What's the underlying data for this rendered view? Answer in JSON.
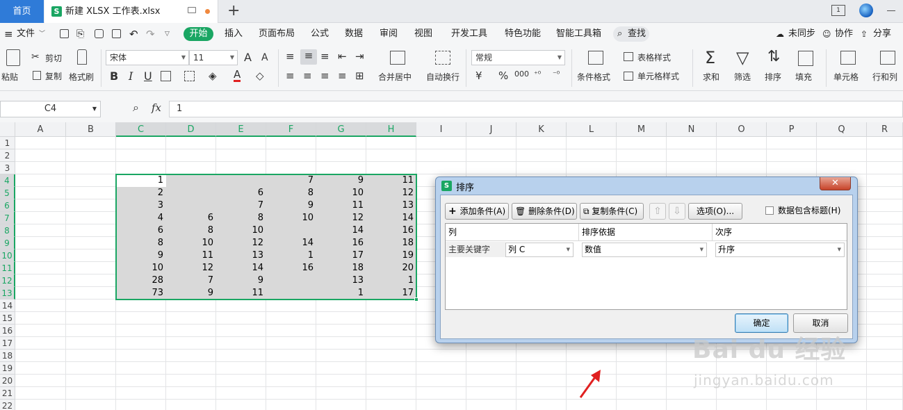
{
  "tabbar": {
    "home": "首页",
    "file_logo": "S",
    "file_name": "新建 XLSX 工作表.xlsx",
    "plus": "+",
    "book_icon_text": "1"
  },
  "menubar": {
    "file_menu": "文件",
    "items": [
      "开始",
      "插入",
      "页面布局",
      "公式",
      "数据",
      "审阅",
      "视图",
      "开发工具",
      "特色功能",
      "智能工具箱"
    ],
    "search": "查找",
    "right": [
      "未同步",
      "协作",
      "分享"
    ]
  },
  "ribbon": {
    "paste": "粘贴",
    "cut": "剪切",
    "copy": "复制",
    "format_painter": "格式刷",
    "font_name": "宋体",
    "font_size": "11",
    "merge_center": "合并居中",
    "wrap_text": "自动换行",
    "number_format": "常规",
    "conditional_format": "条件格式",
    "table_style": "表格样式",
    "cell_style": "单元格样式",
    "sum": "求和",
    "filter": "筛选",
    "sort": "排序",
    "fill": "填充",
    "cells": "单元格",
    "rows_cols": "行和列",
    "bold": "B",
    "italic": "I",
    "underline": "U",
    "font_color": "A",
    "currency": "¥",
    "percent": "%",
    "thousands": "000",
    "font_grow": "A",
    "font_shrink": "A"
  },
  "formulabar": {
    "name_box": "C4",
    "fx": "fx",
    "content": "1"
  },
  "sheet": {
    "columns": [
      "A",
      "B",
      "C",
      "D",
      "E",
      "F",
      "G",
      "H",
      "I",
      "J",
      "K",
      "L",
      "M",
      "N",
      "O",
      "P",
      "Q",
      "R"
    ],
    "rows": [
      "1",
      "2",
      "3",
      "4",
      "5",
      "6",
      "7",
      "8",
      "9",
      "10",
      "11",
      "12",
      "13",
      "14",
      "15",
      "16",
      "17",
      "18",
      "19",
      "20",
      "21",
      "22"
    ],
    "data": [
      [
        "1",
        "",
        "",
        "7",
        "9",
        "11"
      ],
      [
        "2",
        "",
        "6",
        "8",
        "10",
        "12"
      ],
      [
        "3",
        "",
        "7",
        "9",
        "11",
        "13"
      ],
      [
        "4",
        "6",
        "8",
        "10",
        "12",
        "14"
      ],
      [
        "6",
        "8",
        "10",
        "",
        "14",
        "16"
      ],
      [
        "8",
        "10",
        "12",
        "14",
        "16",
        "18"
      ],
      [
        "9",
        "11",
        "13",
        "1",
        "17",
        "19"
      ],
      [
        "10",
        "12",
        "14",
        "16",
        "18",
        "20"
      ],
      [
        "28",
        "7",
        "9",
        "",
        "13",
        "1"
      ],
      [
        "73",
        "9",
        "11",
        "",
        "1",
        "17"
      ]
    ]
  },
  "dialog": {
    "logo": "S",
    "title": "排序",
    "close": "✕",
    "add_condition": "添加条件(A)",
    "delete_condition": "删除条件(D)",
    "copy_condition": "复制条件(C)",
    "up": "⇧",
    "down": "⇩",
    "options": "选项(O)...",
    "has_header": "数据包含标题(H)",
    "col_header": "列",
    "basis_header": "排序依据",
    "order_header": "次序",
    "primary_key": "主要关键字",
    "column_value": "列 C",
    "basis_value": "数值",
    "order_value": "升序",
    "ok": "确定",
    "cancel": "取消"
  },
  "watermark": {
    "main": "Bai du 经验",
    "sub": "jingyan.baidu.com"
  }
}
